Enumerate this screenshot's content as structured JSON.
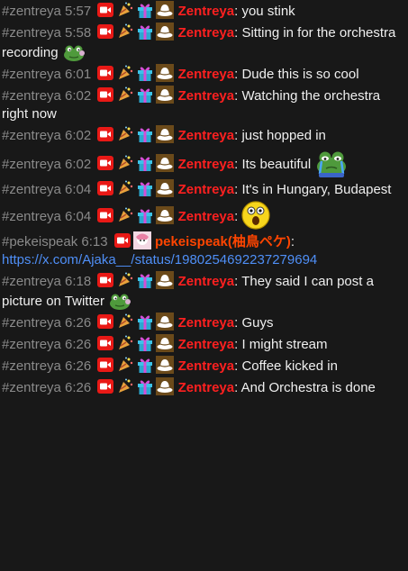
{
  "colors": {
    "zentreya": "#ff2020",
    "pekeispeak": "#ff4500",
    "link": "#4f8ff7",
    "meta": "#8a8a8a"
  },
  "messages": [
    {
      "channel": "#zentreya",
      "time": "5:57",
      "badges": [
        "camera-badge",
        "party-horn-badge",
        "gift-badge",
        "hat-badge"
      ],
      "user": "Zentreya",
      "user_color": "#ff2020",
      "text": "you stink",
      "emote": null
    },
    {
      "channel": "#zentreya",
      "time": "5:58",
      "badges": [
        "camera-badge",
        "party-horn-badge",
        "gift-badge",
        "hat-badge"
      ],
      "user": "Zentreya",
      "user_color": "#ff2020",
      "text": "Sitting in for the orchestra recording",
      "emote": "frog-headphones-emote"
    },
    {
      "channel": "#zentreya",
      "time": "6:01",
      "badges": [
        "camera-badge",
        "party-horn-badge",
        "gift-badge",
        "hat-badge"
      ],
      "user": "Zentreya",
      "user_color": "#ff2020",
      "text": "Dude this is so cool",
      "emote": null
    },
    {
      "channel": "#zentreya",
      "time": "6:02",
      "badges": [
        "camera-badge",
        "party-horn-badge",
        "gift-badge",
        "hat-badge"
      ],
      "user": "Zentreya",
      "user_color": "#ff2020",
      "text": "Watching the orchestra right now",
      "emote": null
    },
    {
      "channel": "#zentreya",
      "time": "6:02",
      "badges": [
        "camera-badge",
        "party-horn-badge",
        "gift-badge",
        "hat-badge"
      ],
      "user": "Zentreya",
      "user_color": "#ff2020",
      "text": "just hopped in",
      "emote": null
    },
    {
      "channel": "#zentreya",
      "time": "6:02",
      "badges": [
        "camera-badge",
        "party-horn-badge",
        "gift-badge",
        "hat-badge"
      ],
      "user": "Zentreya",
      "user_color": "#ff2020",
      "text": "Its beautiful",
      "emote": "frog-cry-emote"
    },
    {
      "channel": "#zentreya",
      "time": "6:04",
      "badges": [
        "camera-badge",
        "party-horn-badge",
        "gift-badge",
        "hat-badge"
      ],
      "user": "Zentreya",
      "user_color": "#ff2020",
      "text": "It's in Hungary, Budapest",
      "emote": null
    },
    {
      "channel": "#zentreya",
      "time": "6:04",
      "badges": [
        "camera-badge",
        "party-horn-badge",
        "gift-badge",
        "hat-badge"
      ],
      "user": "Zentreya",
      "user_color": "#ff2020",
      "text": "",
      "emote": "shocked-face-emote"
    },
    {
      "channel": "#pekeispeak",
      "time": "6:13",
      "badges": [
        "camera-badge",
        "avatar-badge"
      ],
      "user": "pekeispeak(柚鳥ペケ)",
      "user_color": "#ff4500",
      "text": "",
      "link": "https://x.com/Ajaka__/status/1980254692237279694",
      "emote": null
    },
    {
      "channel": "#zentreya",
      "time": "6:18",
      "badges": [
        "camera-badge",
        "party-horn-badge",
        "gift-badge",
        "hat-badge"
      ],
      "user": "Zentreya",
      "user_color": "#ff2020",
      "text": "They said I can post a picture on Twitter",
      "emote": "frog-headphones-emote"
    },
    {
      "channel": "#zentreya",
      "time": "6:26",
      "badges": [
        "camera-badge",
        "party-horn-badge",
        "gift-badge",
        "hat-badge"
      ],
      "user": "Zentreya",
      "user_color": "#ff2020",
      "text": "Guys",
      "emote": null
    },
    {
      "channel": "#zentreya",
      "time": "6:26",
      "badges": [
        "camera-badge",
        "party-horn-badge",
        "gift-badge",
        "hat-badge"
      ],
      "user": "Zentreya",
      "user_color": "#ff2020",
      "text": "I might stream",
      "emote": null
    },
    {
      "channel": "#zentreya",
      "time": "6:26",
      "badges": [
        "camera-badge",
        "party-horn-badge",
        "gift-badge",
        "hat-badge"
      ],
      "user": "Zentreya",
      "user_color": "#ff2020",
      "text": "Coffee kicked in",
      "emote": null
    },
    {
      "channel": "#zentreya",
      "time": "6:26",
      "badges": [
        "camera-badge",
        "party-horn-badge",
        "gift-badge",
        "hat-badge"
      ],
      "user": "Zentreya",
      "user_color": "#ff2020",
      "text": "And Orchestra is done",
      "emote": null
    }
  ]
}
